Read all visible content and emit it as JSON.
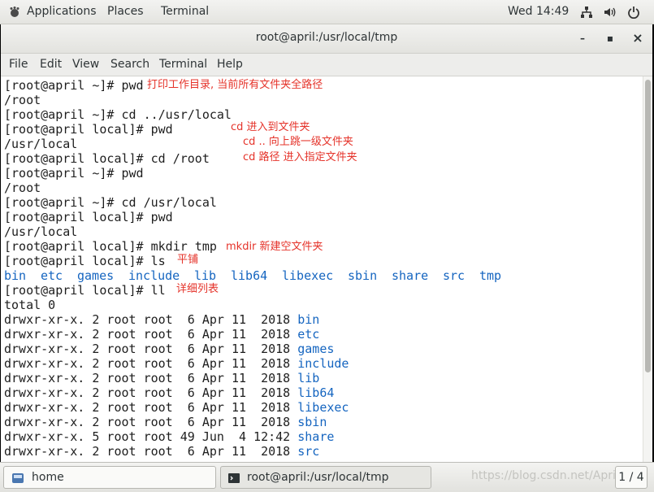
{
  "topbar": {
    "applications": "Applications",
    "places": "Places",
    "terminal": "Terminal",
    "clock": "Wed 14:49"
  },
  "window": {
    "title": "root@april:/usr/local/tmp",
    "minimize": "–",
    "maximize": "▪",
    "close": "×"
  },
  "menu": [
    "File",
    "Edit",
    "View",
    "Search",
    "Terminal",
    "Help"
  ],
  "terminal": {
    "lines": [
      "[root@april ~]# pwd",
      "/root",
      "[root@april ~]# cd ../usr/local",
      "[root@april local]# pwd",
      "/usr/local",
      "[root@april local]# cd /root",
      "[root@april ~]# pwd",
      "/root",
      "[root@april ~]# cd /usr/local",
      "[root@april local]# pwd",
      "/usr/local",
      "[root@april local]# mkdir tmp",
      "[root@april local]# ls",
      "",
      "[root@april local]# ll",
      "total 0"
    ],
    "ls_output": [
      "bin",
      "etc",
      "games",
      "include",
      "lib",
      "lib64",
      "libexec",
      "sbin",
      "share",
      "src",
      "tmp"
    ],
    "ll_rows": [
      {
        "perm": "drwxr-xr-x. 2 root root  6 Apr 11  2018 ",
        "name": "bin"
      },
      {
        "perm": "drwxr-xr-x. 2 root root  6 Apr 11  2018 ",
        "name": "etc"
      },
      {
        "perm": "drwxr-xr-x. 2 root root  6 Apr 11  2018 ",
        "name": "games"
      },
      {
        "perm": "drwxr-xr-x. 2 root root  6 Apr 11  2018 ",
        "name": "include"
      },
      {
        "perm": "drwxr-xr-x. 2 root root  6 Apr 11  2018 ",
        "name": "lib"
      },
      {
        "perm": "drwxr-xr-x. 2 root root  6 Apr 11  2018 ",
        "name": "lib64"
      },
      {
        "perm": "drwxr-xr-x. 2 root root  6 Apr 11  2018 ",
        "name": "libexec"
      },
      {
        "perm": "drwxr-xr-x. 2 root root  6 Apr 11  2018 ",
        "name": "sbin"
      },
      {
        "perm": "drwxr-xr-x. 5 root root 49 Jun  4 12:42 ",
        "name": "share"
      },
      {
        "perm": "drwxr-xr-x. 2 root root  6 Apr 11  2018 ",
        "name": "src"
      }
    ],
    "notes": [
      "打印工作目录, 当前所有文件夹全路径",
      "cd 进入到文件夹",
      "cd .. 向上跳一级文件夹",
      "cd 路径 进入指定文件夹",
      "mkdir 新建空文件夹",
      "平铺",
      "详细列表"
    ]
  },
  "taskbar": {
    "home": "home",
    "terminal_task": "root@april:/usr/local/tmp",
    "pager": "1 / 4",
    "watermark": "https://blog.csdn.net/April_..."
  }
}
